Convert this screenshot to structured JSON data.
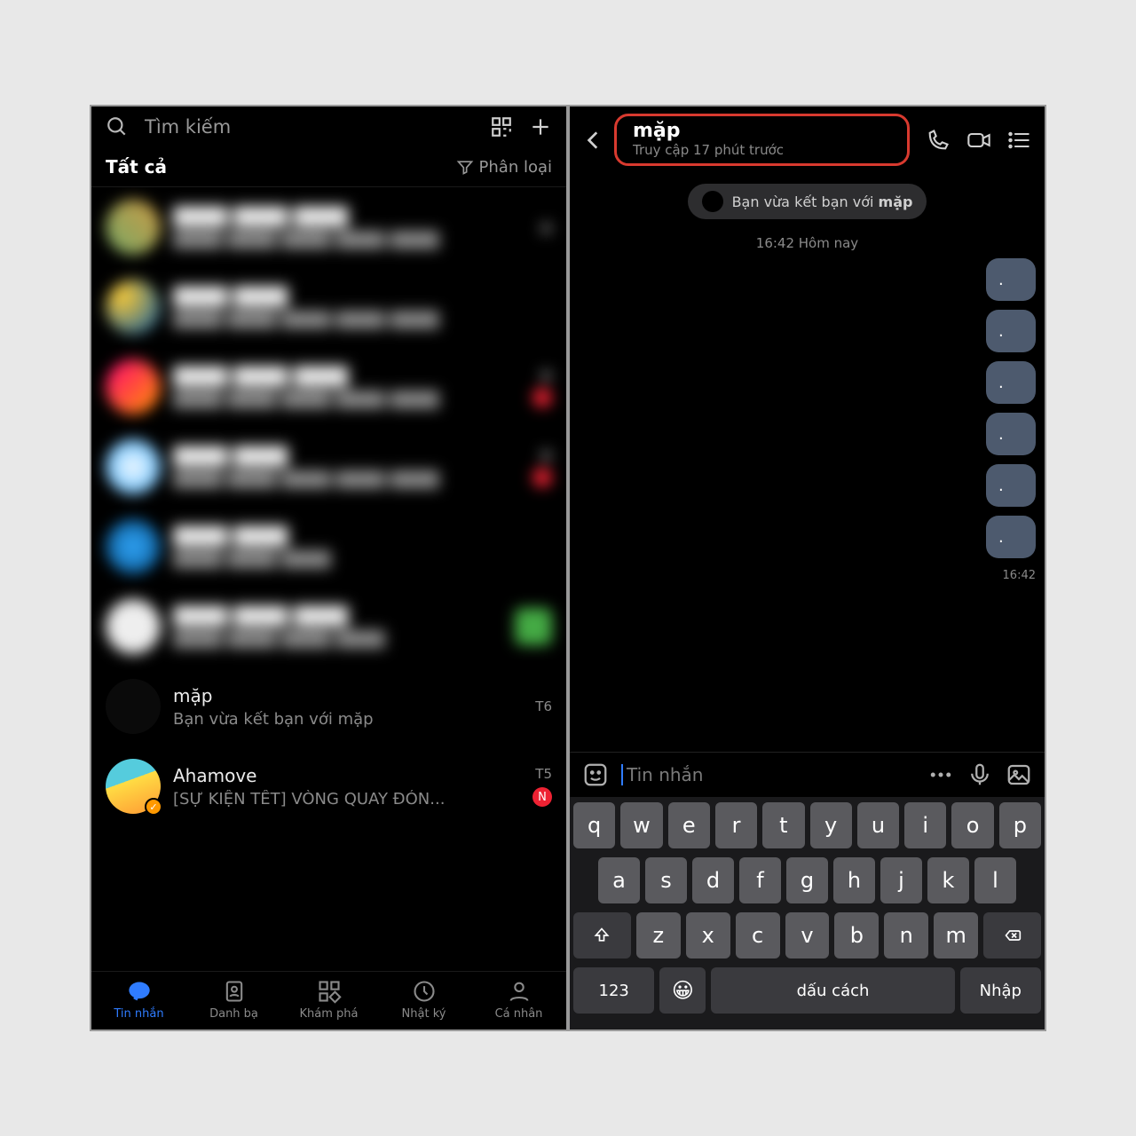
{
  "left": {
    "search_placeholder": "Tìm kiếm",
    "tab_all": "Tất cả",
    "filter_label": "Phân loại",
    "items": [
      {
        "name": "mặp",
        "sub": "Bạn vừa kết bạn với mặp",
        "time": "T6",
        "badge": null
      },
      {
        "name": "Ahamove",
        "sub": "[SỰ KIỆN TẾT] VÒNG QUAY ĐÓN...",
        "time": "T5",
        "badge": "N"
      }
    ],
    "nav": [
      {
        "label": "Tin nhắn",
        "active": true
      },
      {
        "label": "Danh bạ"
      },
      {
        "label": "Khám phá"
      },
      {
        "label": "Nhật ký"
      },
      {
        "label": "Cá nhân"
      }
    ]
  },
  "right": {
    "title": "mặp",
    "subtitle": "Truy cập 17 phút trước",
    "friend_pill_prefix": "Bạn vừa kết bạn với ",
    "friend_pill_name": "mặp",
    "timestamp": "16:42 Hôm nay",
    "messages": [
      ".",
      ".",
      ".",
      ".",
      ".",
      "."
    ],
    "last_time": "16:42",
    "input_placeholder": "Tin nhắn",
    "keyboard": {
      "r1": [
        "q",
        "w",
        "e",
        "r",
        "t",
        "y",
        "u",
        "i",
        "o",
        "p"
      ],
      "r2": [
        "a",
        "s",
        "d",
        "f",
        "g",
        "h",
        "j",
        "k",
        "l"
      ],
      "r3": [
        "z",
        "x",
        "c",
        "v",
        "b",
        "n",
        "m"
      ],
      "num": "123",
      "space": "dấu cách",
      "enter": "Nhập"
    }
  }
}
